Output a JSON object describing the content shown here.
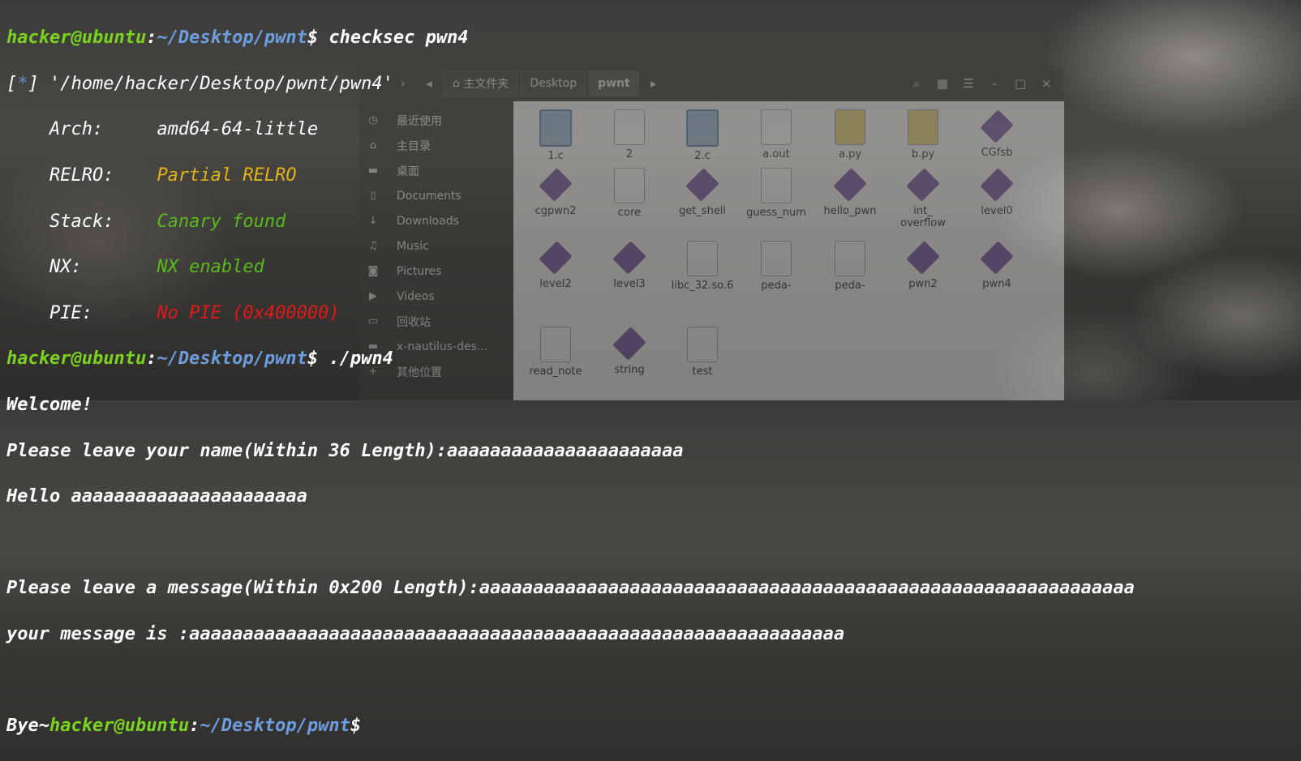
{
  "file_manager": {
    "breadcrumbs": [
      "主文件夹",
      "Desktop",
      "pwnt"
    ],
    "sidebar": [
      {
        "icon": "clock-icon",
        "label": "最近使用"
      },
      {
        "icon": "home-icon",
        "label": "主目录"
      },
      {
        "icon": "folder-icon",
        "label": "桌面"
      },
      {
        "icon": "document-icon",
        "label": "Documents"
      },
      {
        "icon": "download-icon",
        "label": "Downloads"
      },
      {
        "icon": "music-icon",
        "label": "Music"
      },
      {
        "icon": "camera-icon",
        "label": "Pictures"
      },
      {
        "icon": "video-icon",
        "label": "Videos"
      },
      {
        "icon": "trash-icon",
        "label": "回收站"
      },
      {
        "icon": "folder-icon",
        "label": "x-nautilus-des..."
      },
      {
        "icon": "plus-icon",
        "label": "其他位置"
      }
    ],
    "files": [
      {
        "name": "1.c",
        "kind": "c"
      },
      {
        "name": "2",
        "kind": "doc"
      },
      {
        "name": "2.c",
        "kind": "c"
      },
      {
        "name": "a.out",
        "kind": "doc"
      },
      {
        "name": "a.py",
        "kind": "py"
      },
      {
        "name": "b.py",
        "kind": "py"
      },
      {
        "name": "CGfsb",
        "kind": "exe"
      },
      {
        "name": "cgpwn2",
        "kind": "exe"
      },
      {
        "name": "core",
        "kind": "doc"
      },
      {
        "name": "get_shell",
        "kind": "exe"
      },
      {
        "name": "guess_num",
        "kind": "doc"
      },
      {
        "name": "hello_pwn",
        "kind": "exe"
      },
      {
        "name": "int_\noverflow",
        "kind": "exe"
      },
      {
        "name": "level0",
        "kind": "exe"
      },
      {
        "name": "level2",
        "kind": "exe"
      },
      {
        "name": "level3",
        "kind": "exe"
      },
      {
        "name": "libc_32.so.6",
        "kind": "doc"
      },
      {
        "name": "peda-",
        "kind": "doc"
      },
      {
        "name": "peda-",
        "kind": "doc"
      },
      {
        "name": "pwn2",
        "kind": "exe"
      },
      {
        "name": "pwn4",
        "kind": "exe"
      },
      {
        "name": "read_note",
        "kind": "doc"
      },
      {
        "name": "string",
        "kind": "exe"
      },
      {
        "name": "test",
        "kind": "doc"
      }
    ]
  },
  "terminal": {
    "prompt_user": "hacker@ubuntu",
    "prompt_path": "~/Desktop/pwnt",
    "prompt_sign": "$",
    "cmd1": " checksec pwn4",
    "star_open": "[",
    "star": "*",
    "star_close": "] '/home/hacker/Desktop/pwnt/pwn4'",
    "arch_label": "    Arch:     ",
    "arch_value": "amd64-64-little",
    "relro_label": "    RELRO:    ",
    "relro_value": "Partial RELRO",
    "stack_label": "    Stack:    ",
    "stack_value": "Canary found",
    "nx_label": "    NX:       ",
    "nx_value": "NX enabled",
    "pie_label": "    PIE:      ",
    "pie_value": "No PIE (0x400000)",
    "cmd2": " ./pwn4",
    "welcome": "Welcome!",
    "name_prompt": "Please leave your name(Within 36 Length):aaaaaaaaaaaaaaaaaaaaaa",
    "hello": "Hello aaaaaaaaaaaaaaaaaaaaaa",
    "msg_prompt": "Please leave a message(Within 0x200 Length):aaaaaaaaaaaaaaaaaaaaaaaaaaaaaaaaaaaaaaaaaaaaaaaaaaaaaaaaaaaaa",
    "msg_echo": "your message is :aaaaaaaaaaaaaaaaaaaaaaaaaaaaaaaaaaaaaaaaaaaaaaaaaaaaaaaaaaaaa",
    "bye": "Bye~"
  },
  "colors": {
    "prompt_user": "#7ad321",
    "prompt_path": "#6c9dde",
    "relro": "#e0b31a",
    "ok": "#58b91c",
    "bad": "#e01919"
  }
}
